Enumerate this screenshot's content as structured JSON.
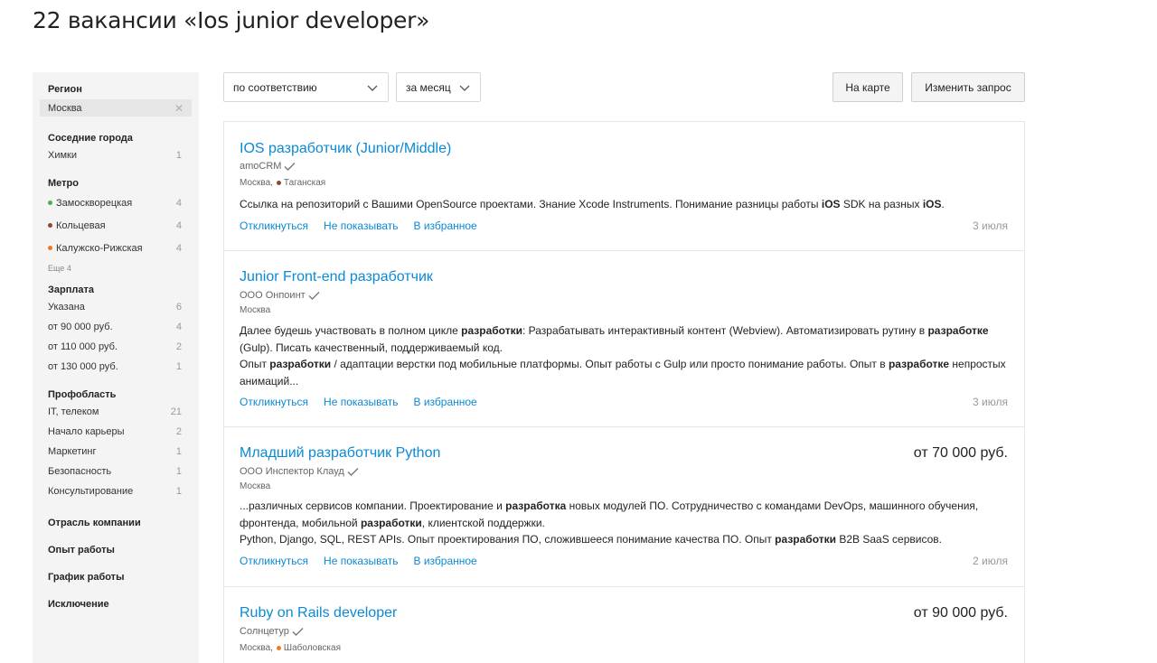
{
  "page": {
    "title": "22 вакансии «Ios junior developer»"
  },
  "sidebar": {
    "region": {
      "heading": "Регион",
      "value": "Москва",
      "clear_icon": "close-icon"
    },
    "nearby": {
      "heading": "Соседние города",
      "items": [
        {
          "label": "Химки",
          "count": "1"
        }
      ]
    },
    "metro": {
      "heading": "Метро",
      "items": [
        {
          "label": "Замоскворецкая",
          "count": "4",
          "color": "#4caf50"
        },
        {
          "label": "Кольцевая",
          "count": "4",
          "color": "#8b4a2b"
        },
        {
          "label": "Калужско-Рижская",
          "count": "4",
          "color": "#f07a22"
        }
      ],
      "more": "Еще 4"
    },
    "salary": {
      "heading": "Зарплата",
      "items": [
        {
          "label": "Указана",
          "count": "6"
        },
        {
          "label": "от 90 000 руб.",
          "count": "4"
        },
        {
          "label": "от 110 000 руб.",
          "count": "2"
        },
        {
          "label": "от 130 000 руб.",
          "count": "1"
        }
      ]
    },
    "profarea": {
      "heading": "Профобласть",
      "items": [
        {
          "label": "IT, телеком",
          "count": "21"
        },
        {
          "label": "Начало карьеры",
          "count": "2"
        },
        {
          "label": "Маркетинг",
          "count": "1"
        },
        {
          "label": "Безопасность",
          "count": "1"
        },
        {
          "label": "Консультирование",
          "count": "1"
        }
      ]
    },
    "collapsed": [
      "Отрасль компании",
      "Опыт работы",
      "График работы",
      "Исключение"
    ]
  },
  "controls": {
    "sort": {
      "value": "по соответствию"
    },
    "period": {
      "value": "за месяц"
    },
    "map_button": "На карте",
    "edit_button": "Изменить запрос"
  },
  "actions": {
    "respond": "Откликнуться",
    "hide": "Не показывать",
    "favorite": "В избранное"
  },
  "vacancies": [
    {
      "title": "IOS разработчик (Junior/Middle)",
      "salary": "",
      "company": "amoCRM",
      "city": "Москва, ",
      "metro": "Таганская",
      "metro_color": "#8b4a2b",
      "description_parts": [
        [
          "Ссылка на репозиторий с Вашими OpenSource проектами. Знание Xcode Instruments. Понимание разницы работы ",
          false
        ],
        [
          "iOS",
          true
        ],
        [
          " SDK на разных ",
          false
        ],
        [
          "iOS",
          true
        ],
        [
          ".",
          false
        ]
      ],
      "date": "3 июля"
    },
    {
      "title": "Junior Front-end разработчик",
      "salary": "",
      "company": "ООО Онпоинт",
      "city": "Москва",
      "metro": "",
      "metro_color": "",
      "description_parts": [
        [
          "Далее будешь участвовать в полном цикле ",
          false
        ],
        [
          "разработки",
          true
        ],
        [
          ": Разрабатывать интерактивный контент (Webview). Автоматизировать рутину в ",
          false
        ],
        [
          "разработке",
          true
        ],
        [
          " (Gulp). Писать качественный, поддерживаемый код.\nОпыт ",
          false
        ],
        [
          "разработки",
          true
        ],
        [
          " / адаптации верстки под мобильные платформы. Опыт работы с Gulp или просто понимание работы. Опыт в ",
          false
        ],
        [
          "разработке",
          true
        ],
        [
          " непростых анимаций...",
          false
        ]
      ],
      "date": "3 июля"
    },
    {
      "title": "Младший разработчик Python",
      "salary": "от 70 000 руб.",
      "company": "ООО Инспектор Клауд",
      "city": "Москва",
      "metro": "",
      "metro_color": "",
      "description_parts": [
        [
          "...различных сервисов компании. Проектирование и ",
          false
        ],
        [
          "разработка",
          true
        ],
        [
          " новых модулей ПО. Сотрудничество с командами DevOps, машинного обучения, фронтенда, мобильной ",
          false
        ],
        [
          "разработки",
          true
        ],
        [
          ", клиентской поддержки.\nPython, Django, SQL, REST APIs. Опыт проектирования ПО, сложившееся понимание качества ПО. Опыт ",
          false
        ],
        [
          "разработки",
          true
        ],
        [
          " B2B SaaS сервисов.",
          false
        ]
      ],
      "date": "2 июля"
    },
    {
      "title": "Ruby on Rails developer",
      "salary": "от 90 000 руб.",
      "company": "Солнцетур",
      "city": "Москва, ",
      "metro": "Шаболовская",
      "metro_color": "#f07a22",
      "description_parts": [],
      "date": ""
    }
  ]
}
